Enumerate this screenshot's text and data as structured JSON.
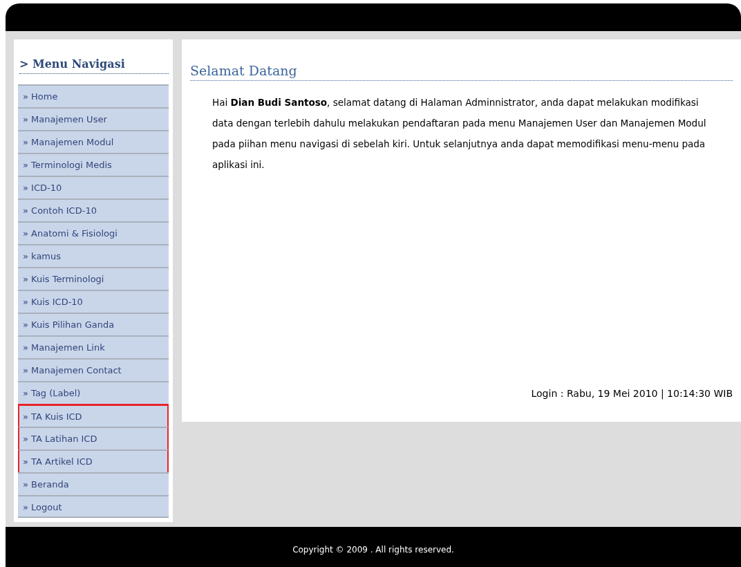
{
  "sidebar": {
    "title": "> Menu Navigasi",
    "items": [
      {
        "label": "» Home",
        "highlighted": false
      },
      {
        "label": "» Manajemen User",
        "highlighted": false
      },
      {
        "label": "» Manajemen Modul",
        "highlighted": false
      },
      {
        "label": "» Terminologi Medis",
        "highlighted": false
      },
      {
        "label": "» ICD-10",
        "highlighted": false
      },
      {
        "label": "» Contoh ICD-10",
        "highlighted": false
      },
      {
        "label": "» Anatomi & Fisiologi",
        "highlighted": false
      },
      {
        "label": "» kamus",
        "highlighted": false
      },
      {
        "label": "» Kuis Terminologi",
        "highlighted": false
      },
      {
        "label": "» Kuis ICD-10",
        "highlighted": false
      },
      {
        "label": "» Kuis Pilihan Ganda",
        "highlighted": false
      },
      {
        "label": "» Manajemen Link",
        "highlighted": false
      },
      {
        "label": "» Manajemen Contact",
        "highlighted": false
      },
      {
        "label": "» Tag (Label)",
        "highlighted": false
      },
      {
        "label": "» TA Kuis ICD",
        "highlighted": true
      },
      {
        "label": "» TA Latihan ICD",
        "highlighted": true
      },
      {
        "label": "» TA Artikel ICD",
        "highlighted": true
      },
      {
        "label": "» Beranda",
        "highlighted": false
      },
      {
        "label": "» Logout",
        "highlighted": false
      }
    ]
  },
  "main": {
    "title": "Selamat Datang",
    "welcome": "Hai **Dian Budi Santoso**, selamat datang di Halaman Adminnistrator, anda dapat melakukan modifikasi data dengan terlebih dahulu melakukan pendaftaran pada menu Manajemen User dan Manajemen Modul pada piihan menu navigasi di sebelah kiri. Untuk selanjutnya anda dapat memodifikasi menu-menu pada aplikasi ini.",
    "login": "Login : Rabu, 19 Mei 2010 | 10:14:30 WIB"
  },
  "footer": {
    "copyright": "Copyright © 2009 . All rights reserved."
  }
}
